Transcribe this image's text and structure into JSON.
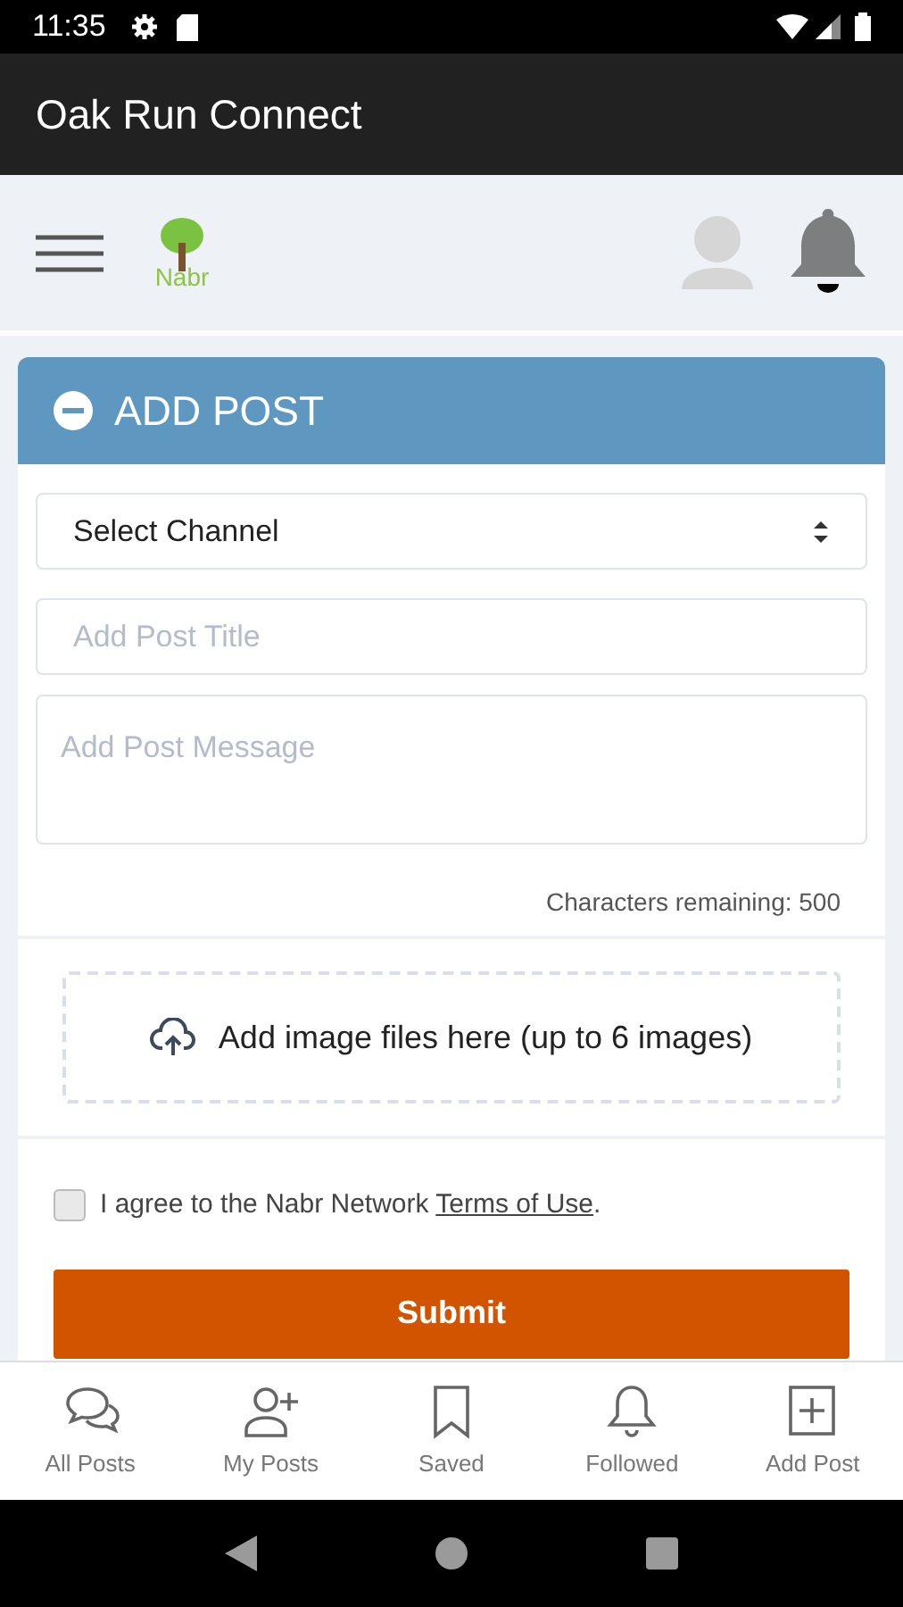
{
  "status_bar": {
    "time": "11:35"
  },
  "app_bar": {
    "title": "Oak Run Connect"
  },
  "header": {
    "logo_text": "Nabr"
  },
  "add_post": {
    "title": "ADD POST",
    "expanded": true,
    "channel_select": {
      "value": "Select Channel"
    },
    "title_field": {
      "placeholder": "Add Post Title"
    },
    "message_field": {
      "placeholder": "Add Post Message"
    },
    "characters_remaining": "Characters remaining: 500",
    "image_drop": {
      "label": "Add image files here (up to 6 images)"
    },
    "agree": {
      "checked": false,
      "text_before": "I agree to the Nabr Network ",
      "link": "Terms of Use",
      "text_after": "."
    },
    "submit": "Submit"
  },
  "bottom_nav": [
    {
      "kind": "chats",
      "label": "All Posts"
    },
    {
      "kind": "user-add",
      "label": "My Posts"
    },
    {
      "kind": "bookmark",
      "label": "Saved"
    },
    {
      "kind": "bell",
      "label": "Followed"
    },
    {
      "kind": "plus-square",
      "label": "Add Post"
    }
  ]
}
